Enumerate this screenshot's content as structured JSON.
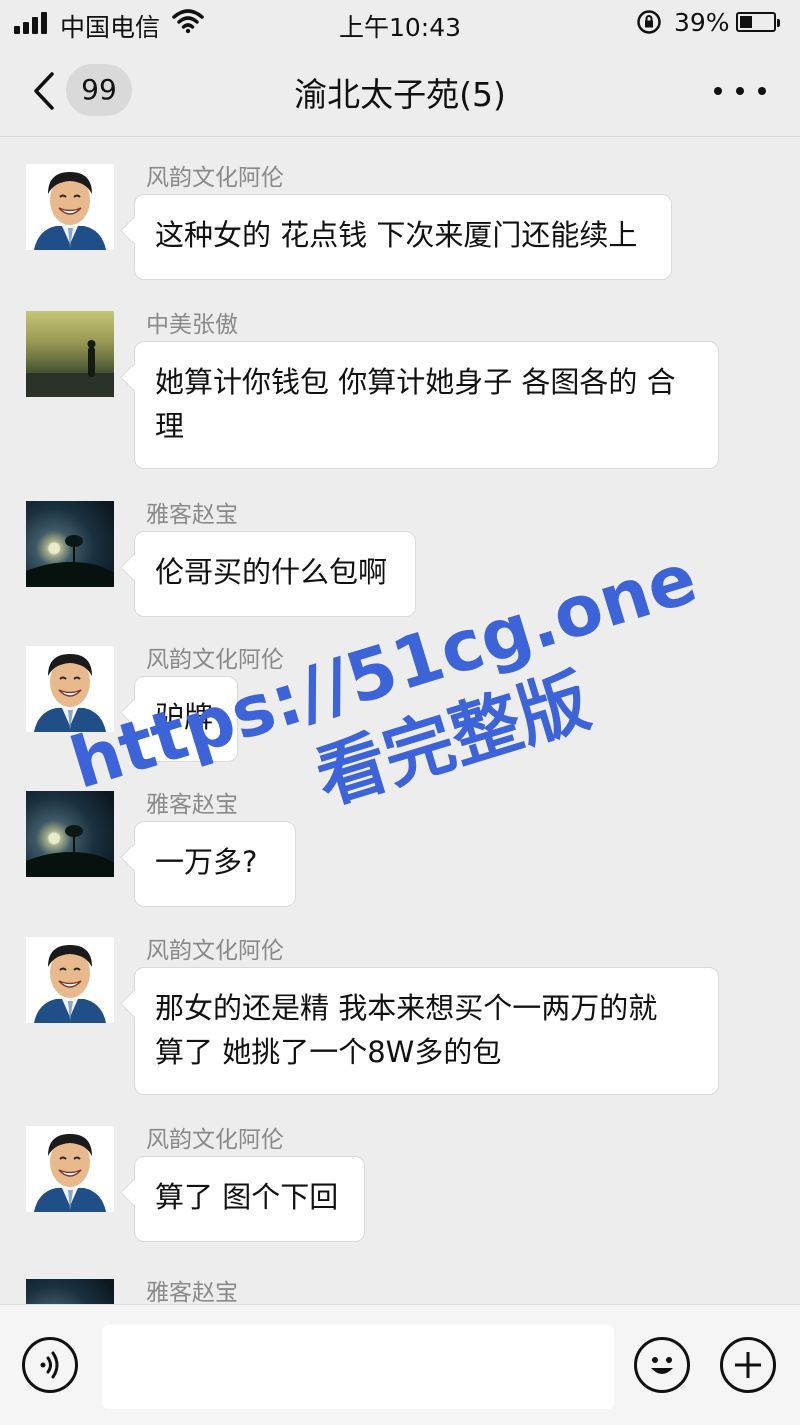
{
  "status_bar": {
    "carrier": "中国电信",
    "time": "上午10:43",
    "battery_percent": "39%",
    "battery_level": 0.39
  },
  "header": {
    "back_badge": "99",
    "title": "渝北太子苑(5)",
    "more_icon": "more-dots-icon"
  },
  "messages": [
    {
      "sender": "风韵文化阿伦",
      "avatar": "man-caricature",
      "lines": [
        "这种女的 花点钱 下次来厦门还能续上"
      ]
    },
    {
      "sender": "中美张傲",
      "avatar": "sunset-figure",
      "lines": [
        "她算计你钱包 你算计她身子 各图各的 合",
        "理"
      ]
    },
    {
      "sender": "雅客赵宝",
      "avatar": "night-tree",
      "lines": [
        "伦哥买的什么包啊"
      ]
    },
    {
      "sender": "风韵文化阿伦",
      "avatar": "man-caricature",
      "lines": [
        "驴牌"
      ]
    },
    {
      "sender": "雅客赵宝",
      "avatar": "night-tree",
      "lines": [
        "一万多?"
      ]
    },
    {
      "sender": "风韵文化阿伦",
      "avatar": "man-caricature",
      "lines": [
        "那女的还是精 我本来想买个一两万的就",
        "算了 她挑了一个8W多的包"
      ]
    },
    {
      "sender": "风韵文化阿伦",
      "avatar": "man-caricature",
      "lines": [
        "算了 图个下回"
      ]
    },
    {
      "sender": "雅客赵宝",
      "avatar": "night-tree",
      "lines": []
    }
  ],
  "watermark": {
    "line1": "https://51cg.one",
    "line2": "看完整版",
    "color": "#3d63d8"
  },
  "input_bar": {
    "voice_icon": "voice-icon",
    "emoji_icon": "emoji-icon",
    "plus_icon": "plus-icon"
  }
}
